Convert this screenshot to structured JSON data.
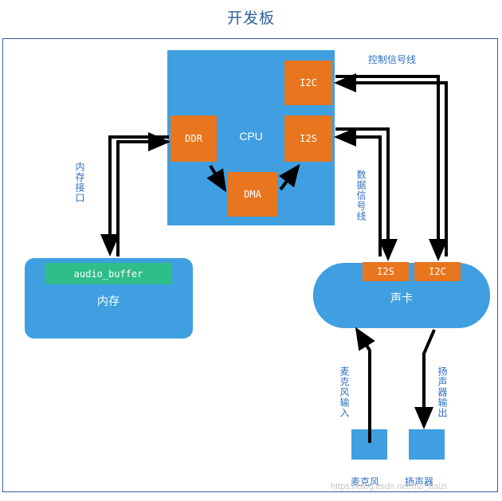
{
  "title": "开发板",
  "blocks": {
    "cpu": "CPU",
    "i2c_cpu": "I2C",
    "ddr": "DDR",
    "i2s_cpu": "I2S",
    "dma": "DMA",
    "memory": "内存",
    "audio_buffer": "audio_buffer",
    "soundcard": "声卡",
    "i2s_sc": "I2S",
    "i2c_sc": "I2C",
    "mic": "麦克风",
    "speaker": "扬声器"
  },
  "labels": {
    "control_line": "控制信号线",
    "data_line": "数据信号线",
    "memory_interface": "内存接口",
    "mic_in": "麦克风输入",
    "spk_out": "扬声器输出"
  },
  "watermark": "https://blog.csdn.net/mo_daizi",
  "colors": {
    "blue_block": "#3f9fe0",
    "orange_block": "#e8761f",
    "green_block": "#2fbd8a",
    "label_text": "#2f6fbf",
    "frame": "#2f5f9e",
    "arrow": "#000000"
  },
  "chart_data": null
}
